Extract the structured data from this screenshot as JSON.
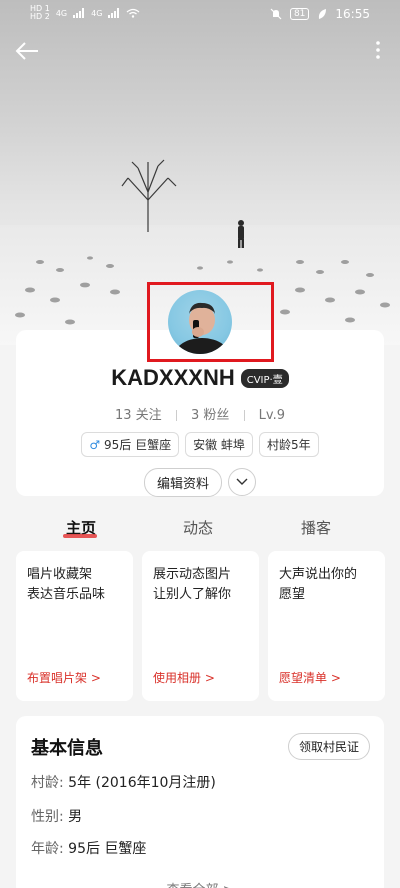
{
  "status_bar": {
    "sim1": "HD 1",
    "sim2": "HD 2",
    "signal1": "4G",
    "signal2": "4G",
    "battery": "81",
    "time": "16:55"
  },
  "profile": {
    "nickname": "KADXXXNH",
    "vip_badge": "CVIP·壹",
    "following": "13 关注",
    "fans": "3 粉丝",
    "level": "Lv.9",
    "tags": [
      "95后 巨蟹座",
      "安徽 蚌埠",
      "村龄5年"
    ],
    "edit_label": "编辑资料"
  },
  "tabs": [
    "主页",
    "动态",
    "播客"
  ],
  "feature_cards": [
    {
      "text": "唱片收藏架\n表达音乐品味",
      "link": "布置唱片架 >"
    },
    {
      "text": "展示动态图片\n让别人了解你",
      "link": "使用相册 >"
    },
    {
      "text": "大声说出你的\n愿望",
      "link": "愿望清单 >"
    }
  ],
  "basic_info": {
    "title": "基本信息",
    "claim_button": "领取村民证",
    "rows": [
      {
        "key": "村龄:",
        "value": "5年 (2016年10月注册)"
      },
      {
        "key": "性别:",
        "value": "男"
      },
      {
        "key": "年龄:",
        "value": "95后 巨蟹座"
      }
    ],
    "view_all": "查看全部 >"
  },
  "colors": {
    "accent_red": "#e0191f",
    "link_red": "#d9312a",
    "male_blue": "#2f8be0"
  }
}
